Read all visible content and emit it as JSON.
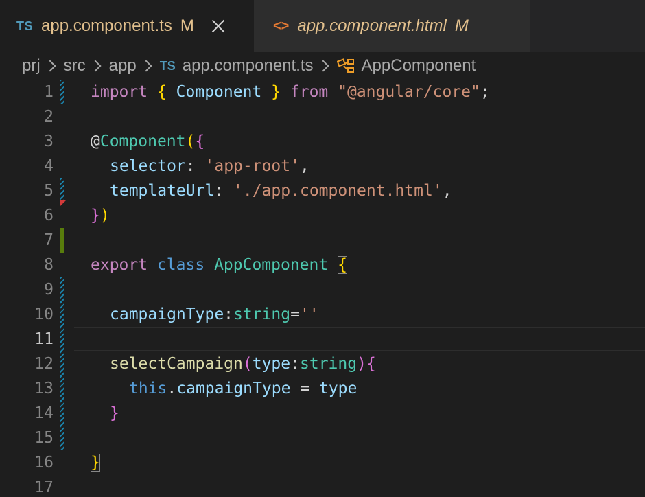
{
  "tabs": [
    {
      "icon": "TS",
      "title": "app.component.ts",
      "status": "M",
      "active": true
    },
    {
      "icon": "<>",
      "title": "app.component.html",
      "status": "M",
      "active": false
    }
  ],
  "breadcrumb": [
    "prj",
    "src",
    "app",
    "app.component.ts",
    "AppComponent"
  ],
  "breadcrumb_file_icon": "TS",
  "icons": {
    "close": "close-icon",
    "typescript": "typescript-file-icon",
    "html": "html-file-icon",
    "class": "class-symbol-icon",
    "chevron": "chevron-right-icon"
  },
  "line_numbers": [
    "1",
    "2",
    "3",
    "4",
    "5",
    "6",
    "7",
    "8",
    "9",
    "10",
    "11",
    "12",
    "13",
    "14",
    "15",
    "16",
    "17"
  ],
  "code": {
    "l1": {
      "import": "import",
      "ob": "{",
      "component": "Component",
      "cb": "}",
      "from": "from",
      "module": "\"@angular/core\"",
      "semi": ";"
    },
    "l3": {
      "at": "@",
      "decorator": "Component",
      "op": "(",
      "ob": "{"
    },
    "l4": {
      "key": "selector",
      "colon": ":",
      "val": "'app-root'",
      "comma": ","
    },
    "l5": {
      "key": "templateUrl",
      "colon": ":",
      "val": "'./app.component.html'",
      "comma": ","
    },
    "l6": {
      "cb": "}",
      "cp": ")"
    },
    "l8": {
      "export": "export",
      "class": "class",
      "name": "AppComponent",
      "ob": "{"
    },
    "l10": {
      "prop": "campaignType",
      "colon": ":",
      "type": "string",
      "eq": "=",
      "val": "''"
    },
    "l12": {
      "fn": "selectCampaign",
      "op": "(",
      "param": "type",
      "colon": ":",
      "type": "string",
      "cp": ")",
      "ob": "{"
    },
    "l13": {
      "this": "this",
      "dot": ".",
      "prop": "campaignType",
      "eq": " = ",
      "val": "type"
    },
    "l14": {
      "cb": "}"
    },
    "l16": {
      "cb": "}"
    }
  },
  "colors": {
    "background": "#1e1e1e",
    "keyword": "#c586c0",
    "storage": "#569cd6",
    "type": "#4ec9b0",
    "variable": "#9cdcfe",
    "function": "#dcdcaa",
    "string": "#ce9178",
    "modified_tab": "#e2c08d",
    "git_modified": "#1b81a8",
    "git_added": "#587c0c"
  }
}
